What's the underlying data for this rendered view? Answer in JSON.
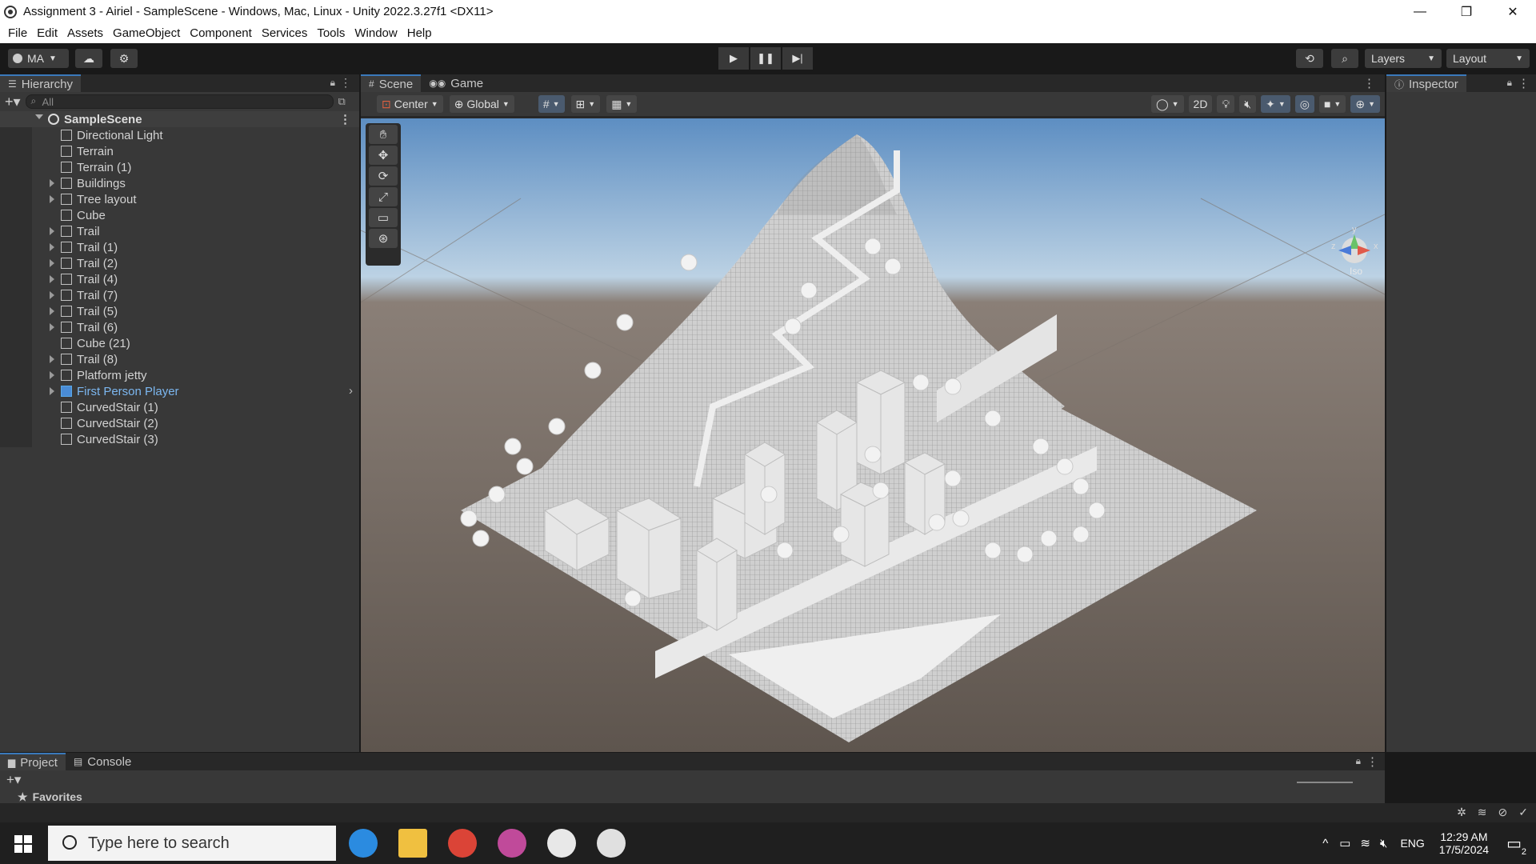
{
  "window": {
    "title": "Assignment 3 - Airiel - SampleScene - Windows, Mac, Linux - Unity 2022.3.27f1 <DX11>",
    "min": "—",
    "max": "❐",
    "close": "✕"
  },
  "menu": [
    "File",
    "Edit",
    "Assets",
    "GameObject",
    "Component",
    "Services",
    "Tools",
    "Window",
    "Help"
  ],
  "toolbar": {
    "account": "MA",
    "layers": "Layers",
    "layout": "Layout"
  },
  "hierarchy": {
    "tab": "Hierarchy",
    "search_placeholder": "All",
    "scene": "SampleScene",
    "items": [
      {
        "label": "Directional Light",
        "expandable": false
      },
      {
        "label": "Terrain",
        "expandable": false
      },
      {
        "label": "Terrain (1)",
        "expandable": false
      },
      {
        "label": "Buildings",
        "expandable": true
      },
      {
        "label": "Tree layout",
        "expandable": true
      },
      {
        "label": "Cube",
        "expandable": false
      },
      {
        "label": "Trail",
        "expandable": true
      },
      {
        "label": "Trail (1)",
        "expandable": true
      },
      {
        "label": "Trail (2)",
        "expandable": true
      },
      {
        "label": "Trail (4)",
        "expandable": true
      },
      {
        "label": "Trail (7)",
        "expandable": true
      },
      {
        "label": "Trail (5)",
        "expandable": true
      },
      {
        "label": "Trail (6)",
        "expandable": true
      },
      {
        "label": "Cube (21)",
        "expandable": false
      },
      {
        "label": "Trail (8)",
        "expandable": true
      },
      {
        "label": "Platform jetty",
        "expandable": true
      },
      {
        "label": "First Person Player",
        "expandable": true,
        "prefab": true
      },
      {
        "label": "CurvedStair (1)",
        "expandable": false
      },
      {
        "label": "CurvedStair (2)",
        "expandable": false
      },
      {
        "label": "CurvedStair (3)",
        "expandable": false
      }
    ]
  },
  "scene": {
    "tabs": [
      "Scene",
      "Game"
    ],
    "pivot": "Center",
    "space": "Global",
    "mode_2d": "2D",
    "gizmo_label": "Iso",
    "gizmo_axes": [
      "y",
      "z",
      "x"
    ]
  },
  "inspector": {
    "tab": "Inspector"
  },
  "project": {
    "tabs": [
      "Project",
      "Console"
    ],
    "favorites": "Favorites"
  },
  "taskbar": {
    "search_placeholder": "Type here to search",
    "lang": "ENG",
    "time": "12:29 AM",
    "date": "17/5/2024",
    "notifications": "2"
  }
}
